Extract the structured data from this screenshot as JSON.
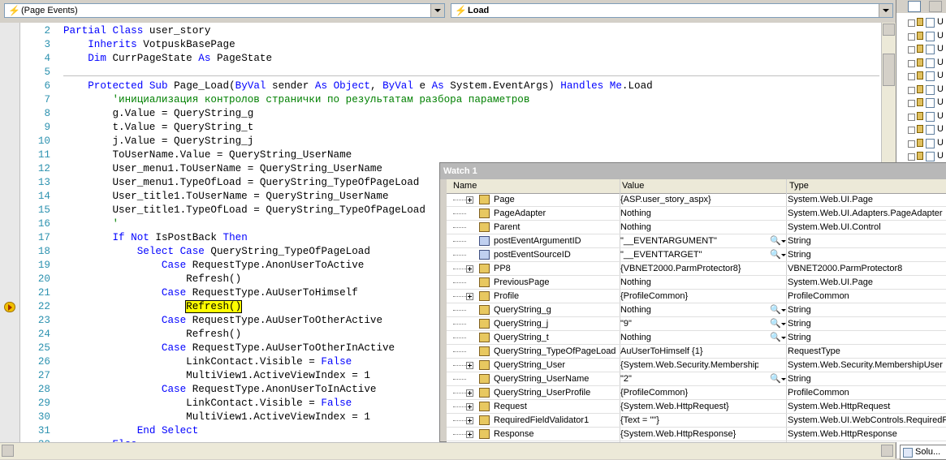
{
  "dropdowns": {
    "left": "(Page Events)",
    "right": "Load"
  },
  "code_lines": [
    {
      "n": "2",
      "html": "<span class=\"kw\">Partial</span> <span class=\"kw\">Class</span> user_story"
    },
    {
      "n": "3",
      "html": "    <span class=\"kw\">Inherits</span> VotpuskBasePage"
    },
    {
      "n": "4",
      "html": "    <span class=\"kw\">Dim</span> CurrPageState <span class=\"kw\">As</span> PageState"
    },
    {
      "n": "5",
      "html": ""
    },
    {
      "n": "6",
      "html": "    <span class=\"kw\">Protected</span> <span class=\"kw\">Sub</span> Page_Load(<span class=\"kw\">ByVal</span> sender <span class=\"kw\">As</span> <span class=\"kw\">Object</span>, <span class=\"kw\">ByVal</span> e <span class=\"kw\">As</span> System.EventArgs) <span class=\"kw\">Handles</span> <span class=\"kw\">Me</span>.Load"
    },
    {
      "n": "7",
      "html": "        <span class=\"cm\">'инициализация контролов странички по результатам разбора параметров</span>"
    },
    {
      "n": "8",
      "html": "        g.Value = QueryString_g"
    },
    {
      "n": "9",
      "html": "        t.Value = QueryString_t"
    },
    {
      "n": "10",
      "html": "        j.Value = QueryString_j"
    },
    {
      "n": "11",
      "html": "        ToUserName.Value = QueryString_UserName"
    },
    {
      "n": "12",
      "html": "        User_menu1.ToUserName = QueryString_UserName"
    },
    {
      "n": "13",
      "html": "        User_menu1.TypeOfLoad = QueryString_TypeOfPageLoad"
    },
    {
      "n": "14",
      "html": "        User_title1.ToUserName = QueryString_UserName"
    },
    {
      "n": "15",
      "html": "        User_title1.TypeOfLoad = QueryString_TypeOfPageLoad"
    },
    {
      "n": "16",
      "html": "        <span class=\"cm\">'</span>"
    },
    {
      "n": "17",
      "html": "        <span class=\"kw\">If</span> <span class=\"kw\">Not</span> IsPostBack <span class=\"kw\">Then</span>"
    },
    {
      "n": "18",
      "html": "            <span class=\"kw\">Select</span> <span class=\"kw\">Case</span> QueryString_TypeOfPageLoad"
    },
    {
      "n": "19",
      "html": "                <span class=\"kw\">Case</span> RequestType.AnonUserToActive"
    },
    {
      "n": "20",
      "html": "                    Refresh()"
    },
    {
      "n": "21",
      "html": "                <span class=\"kw\">Case</span> RequestType.AuUserToHimself"
    },
    {
      "n": "22",
      "html": "                    <span class=\"hl\">Refresh()</span>"
    },
    {
      "n": "23",
      "html": "                <span class=\"kw\">Case</span> RequestType.AuUserToOtherActive"
    },
    {
      "n": "24",
      "html": "                    Refresh()"
    },
    {
      "n": "25",
      "html": "                <span class=\"kw\">Case</span> RequestType.AuUserToOtherInActive"
    },
    {
      "n": "26",
      "html": "                    LinkContact.Visible = <span class=\"kw\">False</span>"
    },
    {
      "n": "27",
      "html": "                    MultiView1.ActiveViewIndex = 1"
    },
    {
      "n": "28",
      "html": "                <span class=\"kw\">Case</span> RequestType.AnonUserToInActive"
    },
    {
      "n": "29",
      "html": "                    LinkContact.Visible = <span class=\"kw\">False</span>"
    },
    {
      "n": "30",
      "html": "                    MultiView1.ActiveViewIndex = 1"
    },
    {
      "n": "31",
      "html": "            <span class=\"kw\">End</span> <span class=\"kw\">Select</span>"
    },
    {
      "n": "32",
      "html": "        <span class=\"kw\">Else</span>"
    }
  ],
  "watch": {
    "title": "Watch 1",
    "columns": [
      "Name",
      "Value",
      "Type"
    ],
    "rows": [
      {
        "name": "Page",
        "value": "{ASP.user_story_aspx}",
        "type": "System.Web.UI.Page",
        "expand": true,
        "icon": "field"
      },
      {
        "name": "PageAdapter",
        "value": "Nothing",
        "type": "System.Web.UI.Adapters.PageAdapter",
        "expand": false,
        "icon": "field"
      },
      {
        "name": "Parent",
        "value": "Nothing",
        "type": "System.Web.UI.Control",
        "expand": false,
        "icon": "field"
      },
      {
        "name": "postEventArgumentID",
        "value": "\"__EVENTARGUMENT\"",
        "type": "String",
        "expand": false,
        "icon": "prop",
        "mag": true
      },
      {
        "name": "postEventSourceID",
        "value": "\"__EVENTTARGET\"",
        "type": "String",
        "expand": false,
        "icon": "prop",
        "mag": true
      },
      {
        "name": "PP8",
        "value": "{VBNET2000.ParmProtector8}",
        "type": "VBNET2000.ParmProtector8",
        "expand": true,
        "icon": "field"
      },
      {
        "name": "PreviousPage",
        "value": "Nothing",
        "type": "System.Web.UI.Page",
        "expand": false,
        "icon": "field"
      },
      {
        "name": "Profile",
        "value": "{ProfileCommon}",
        "type": "ProfileCommon",
        "expand": true,
        "icon": "field"
      },
      {
        "name": "QueryString_g",
        "value": "Nothing",
        "type": "String",
        "expand": false,
        "icon": "field",
        "mag": true
      },
      {
        "name": "QueryString_j",
        "value": "\"9\"",
        "type": "String",
        "expand": false,
        "icon": "field",
        "mag": true
      },
      {
        "name": "QueryString_t",
        "value": "Nothing",
        "type": "String",
        "expand": false,
        "icon": "field",
        "mag": true
      },
      {
        "name": "QueryString_TypeOfPageLoad",
        "value": "AuUserToHimself {1}",
        "type": "RequestType",
        "expand": false,
        "icon": "field"
      },
      {
        "name": "QueryString_User",
        "value": "{System.Web.Security.MembershipUser}",
        "type": "System.Web.Security.MembershipUser",
        "expand": true,
        "icon": "field"
      },
      {
        "name": "QueryString_UserName",
        "value": "\"2\"",
        "type": "String",
        "expand": false,
        "icon": "field",
        "mag": true
      },
      {
        "name": "QueryString_UserProfile",
        "value": "{ProfileCommon}",
        "type": "ProfileCommon",
        "expand": true,
        "icon": "field"
      },
      {
        "name": "Request",
        "value": "{System.Web.HttpRequest}",
        "type": "System.Web.HttpRequest",
        "expand": true,
        "icon": "field"
      },
      {
        "name": "RequiredFieldValidator1",
        "value": "{Text = \"\"}",
        "type": "System.Web.UI.WebControls.RequiredF",
        "expand": true,
        "icon": "field"
      },
      {
        "name": "Response",
        "value": "{System.Web.HttpResponse}",
        "type": "System.Web.HttpResponse",
        "expand": true,
        "icon": "field"
      }
    ]
  },
  "solution_tab": "Solu...",
  "solution_items": [
    "U",
    "U",
    "U",
    "U",
    "U",
    "U",
    "U",
    "U",
    "U",
    "U",
    "U"
  ],
  "current_line": "22"
}
